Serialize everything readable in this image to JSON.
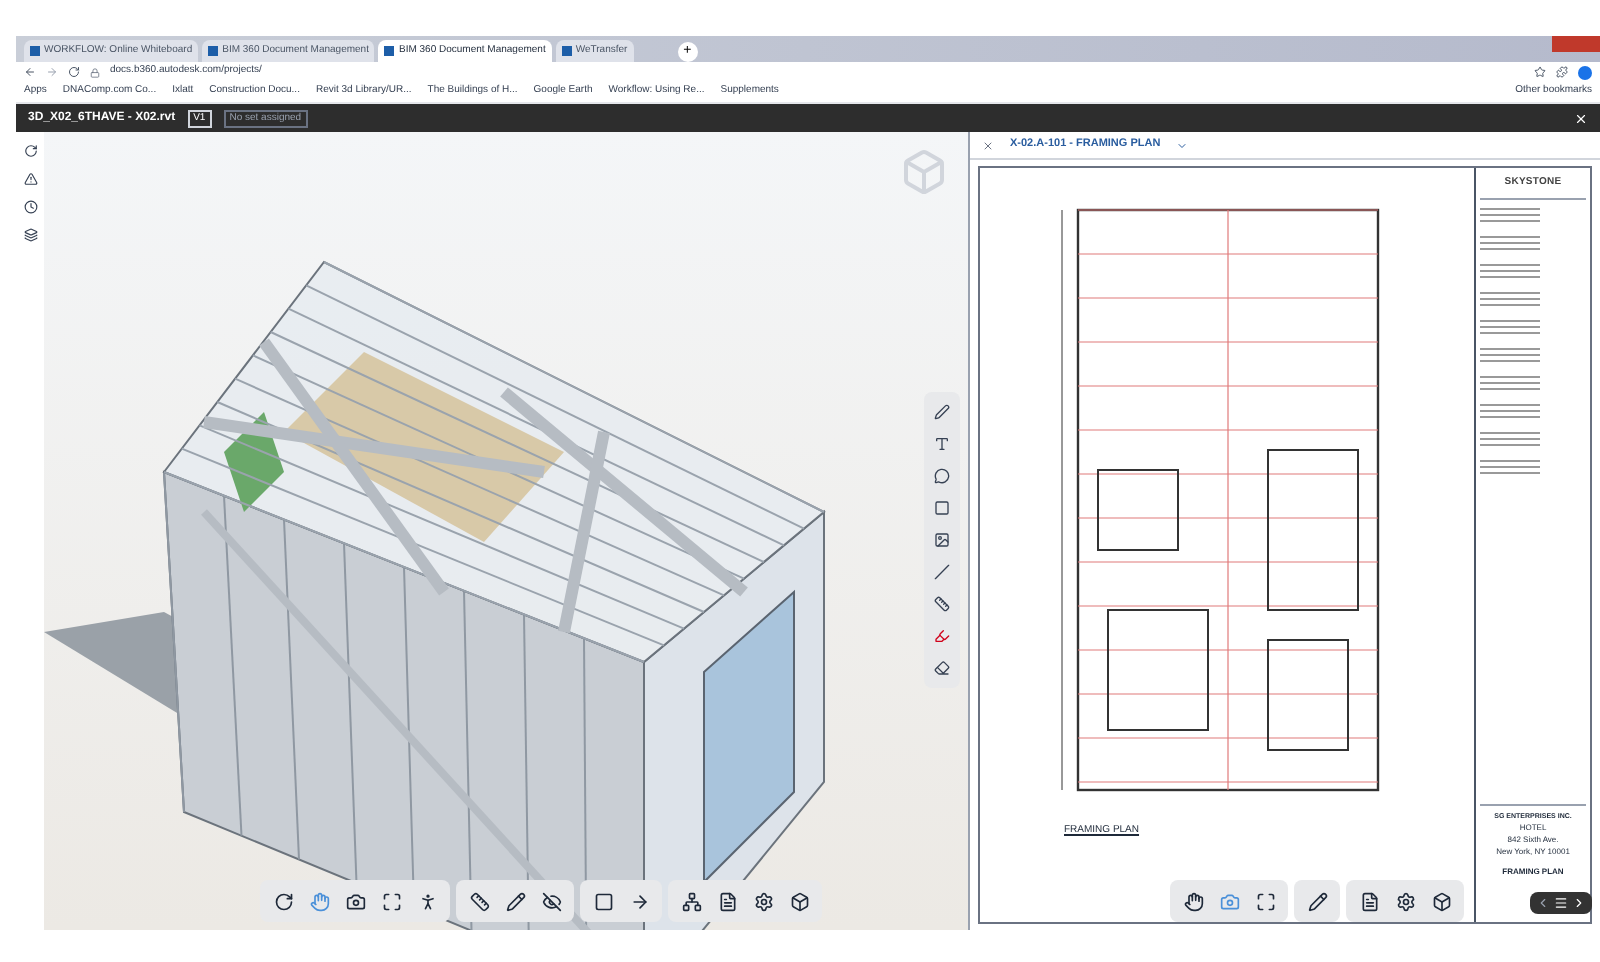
{
  "browser": {
    "tabs": [
      {
        "label": "WORKFLOW: Online Whiteboard",
        "selected": false
      },
      {
        "label": "BIM 360 Document Management",
        "selected": false
      },
      {
        "label": "BIM 360 Document Management",
        "selected": true
      },
      {
        "label": "WeTransfer",
        "selected": false
      }
    ],
    "new_tab": "+",
    "url": "docs.b360.autodesk.com/projects/",
    "bookmarks": [
      "Apps",
      "DNAComp.com Co...",
      "Ixlatt",
      "Construction Docu...",
      "Revit 3d Library/UR...",
      "The Buildings of H...",
      "Google Earth",
      "Workflow: Using Re...",
      "Supplements"
    ],
    "other_bookmarks": "Other bookmarks"
  },
  "header": {
    "file": "3D_X02_6THAVE - X02.rvt",
    "version": "V1",
    "set": "No set assigned"
  },
  "sheet": {
    "title": "X-02.A-101 - FRAMING PLAN",
    "plan_label": "FRAMING PLAN",
    "title_block": {
      "firm": "SKYSTONE",
      "owner": "SG ENTERPRISES INC.",
      "project": [
        "HOTEL",
        "842 Sixth Ave.",
        "New York, NY 10001"
      ],
      "sheet_name": "FRAMING PLAN"
    }
  }
}
